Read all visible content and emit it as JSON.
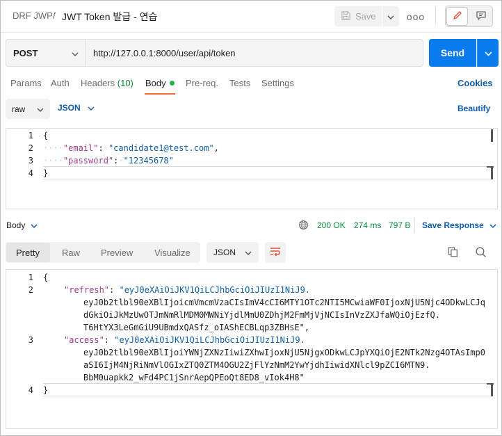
{
  "header": {
    "collection": "DRF JWP",
    "separator": "/",
    "request_name": "JWT Token 발급 - 연습",
    "save_label": "Save",
    "more_label": "ooo"
  },
  "request": {
    "method": "POST",
    "url": "http://127.0.0.1:8000/user/api/token",
    "send_label": "Send"
  },
  "request_tabs": {
    "params": "Params",
    "auth": "Auth",
    "headers": "Headers",
    "headers_count": "(10)",
    "body": "Body",
    "prereq": "Pre-req.",
    "tests": "Tests",
    "settings": "Settings",
    "cookies": "Cookies"
  },
  "body_options": {
    "mode": "raw",
    "language": "JSON",
    "beautify": "Beautify"
  },
  "request_body": {
    "line_numbers": [
      "1",
      "2",
      "3",
      "4"
    ],
    "open_brace": "{",
    "close_brace": "}",
    "email_key": "\"email\"",
    "email_value": "\"candidate1@test.com\"",
    "password_key": "\"password\"",
    "password_value": "\"12345678\""
  },
  "response_bar": {
    "label": "Body",
    "status": "200 OK",
    "time": "274 ms",
    "size": "797 B",
    "save_response": "Save Response"
  },
  "response_tabs": {
    "pretty": "Pretty",
    "raw": "Raw",
    "preview": "Preview",
    "visualize": "Visualize",
    "format": "JSON"
  },
  "response_body": {
    "line_numbers": [
      "1",
      "2",
      "3",
      "4"
    ],
    "open_brace": "{",
    "close_brace": "}",
    "refresh_key": "\"refresh\"",
    "refresh_lines": [
      "\"eyJ0eXAiOiJKV1QiLCJhbGciOiJIUzI1NiJ9.",
      "eyJ0b2tlbl90eXBlIjoicmVmcmVzaCIsImV4cCI6MTY1OTc2NTI5MCwiaWF0IjoxNjU5Njc4ODkwLCJq",
      "dGkiOiJkMzUwOTJmNmRlMDM0MWNiYjdlMmU0ZDhjM2FmMjVjNCIsInVzZXJfaWQiOjEzfQ.",
      "T6HtYX3LeGmGiU9UBmdxQASfz_oIAShECBLqp3ZBHsE\","
    ],
    "access_key": "\"access\"",
    "access_lines": [
      "\"eyJ0eXAiOiJKV1QiLCJhbGciOiJIUzI1NiJ9.",
      "eyJ0b2tlbl90eXBlIjoiYWNjZXNzIiwiZXhwIjoxNjU5NjgxODkwLCJpYXQiOjE2NTk2Nzg4OTAsImp0",
      "aSI6IjM4NjRiNmVlOGIxZTQ0ZTM4OGU2ZjFlYzNmM2YwYjdhIiwidXNlcl9pZCI6MTN9.",
      "BbM0uapkk2_wFd4PC1jSnrAepQPEoQt8ED8_vIok4H8\""
    ]
  }
}
